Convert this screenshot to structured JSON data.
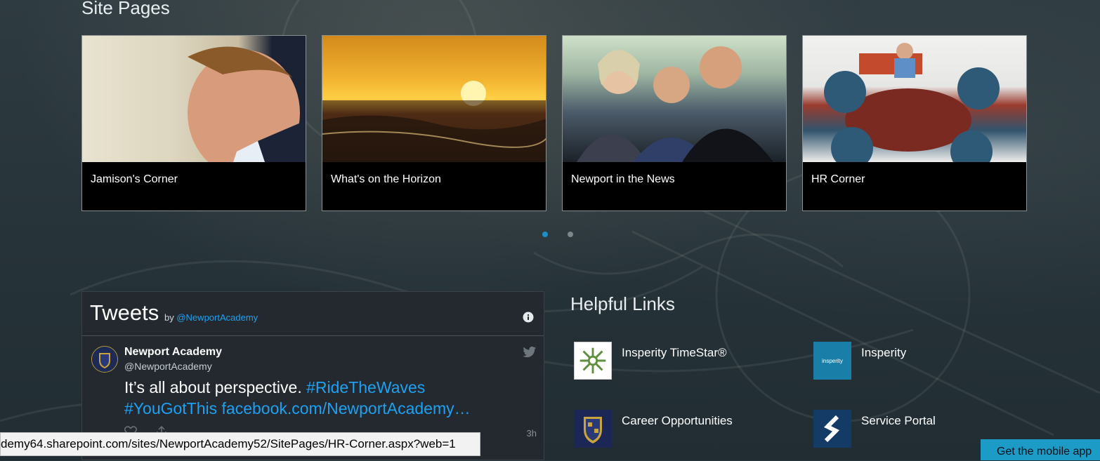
{
  "site_pages": {
    "title": "Site Pages",
    "cards": [
      {
        "label": "Jamison's Corner",
        "image": "man-speaking-photo"
      },
      {
        "label": "What's on the Horizon",
        "image": "ocean-sunset-photo"
      },
      {
        "label": "Newport in the News",
        "image": "family-smiling-photo"
      },
      {
        "label": "HR Corner",
        "image": "group-meeting-photo"
      }
    ],
    "pager": {
      "pages": 2,
      "active": 1
    }
  },
  "tweets": {
    "title": "Tweets",
    "by": "by",
    "handle": "@NewportAcademy",
    "tweet": {
      "name": "Newport Academy",
      "username": "@NewportAcademy",
      "text_plain": "It’s all about perspective. ",
      "hashtag1": "#RideTheWaves",
      "hashtag2": "#YouGotThis",
      "link": "facebook.com/NewportAcademy…",
      "time": "3h"
    }
  },
  "helpful_links": {
    "title": "Helpful Links",
    "items": [
      {
        "label": "Insperity TimeStar®",
        "icon": "timestar-logo"
      },
      {
        "label": "Insperity",
        "icon": "insperity-logo",
        "logo_text": "insperity"
      },
      {
        "label": "Career Opportunities",
        "icon": "academy-crest-logo"
      },
      {
        "label": "Service Portal",
        "icon": "service-portal-logo"
      }
    ]
  },
  "status_bar": {
    "url": "demy64.sharepoint.com/sites/NewportAcademy52/SitePages/HR-Corner.aspx?web=1"
  },
  "mobile_app_button": "Get the mobile app",
  "colors": {
    "accent": "#1d9bc7",
    "twitter_blue": "#1da1f2",
    "background": "#26343b"
  }
}
